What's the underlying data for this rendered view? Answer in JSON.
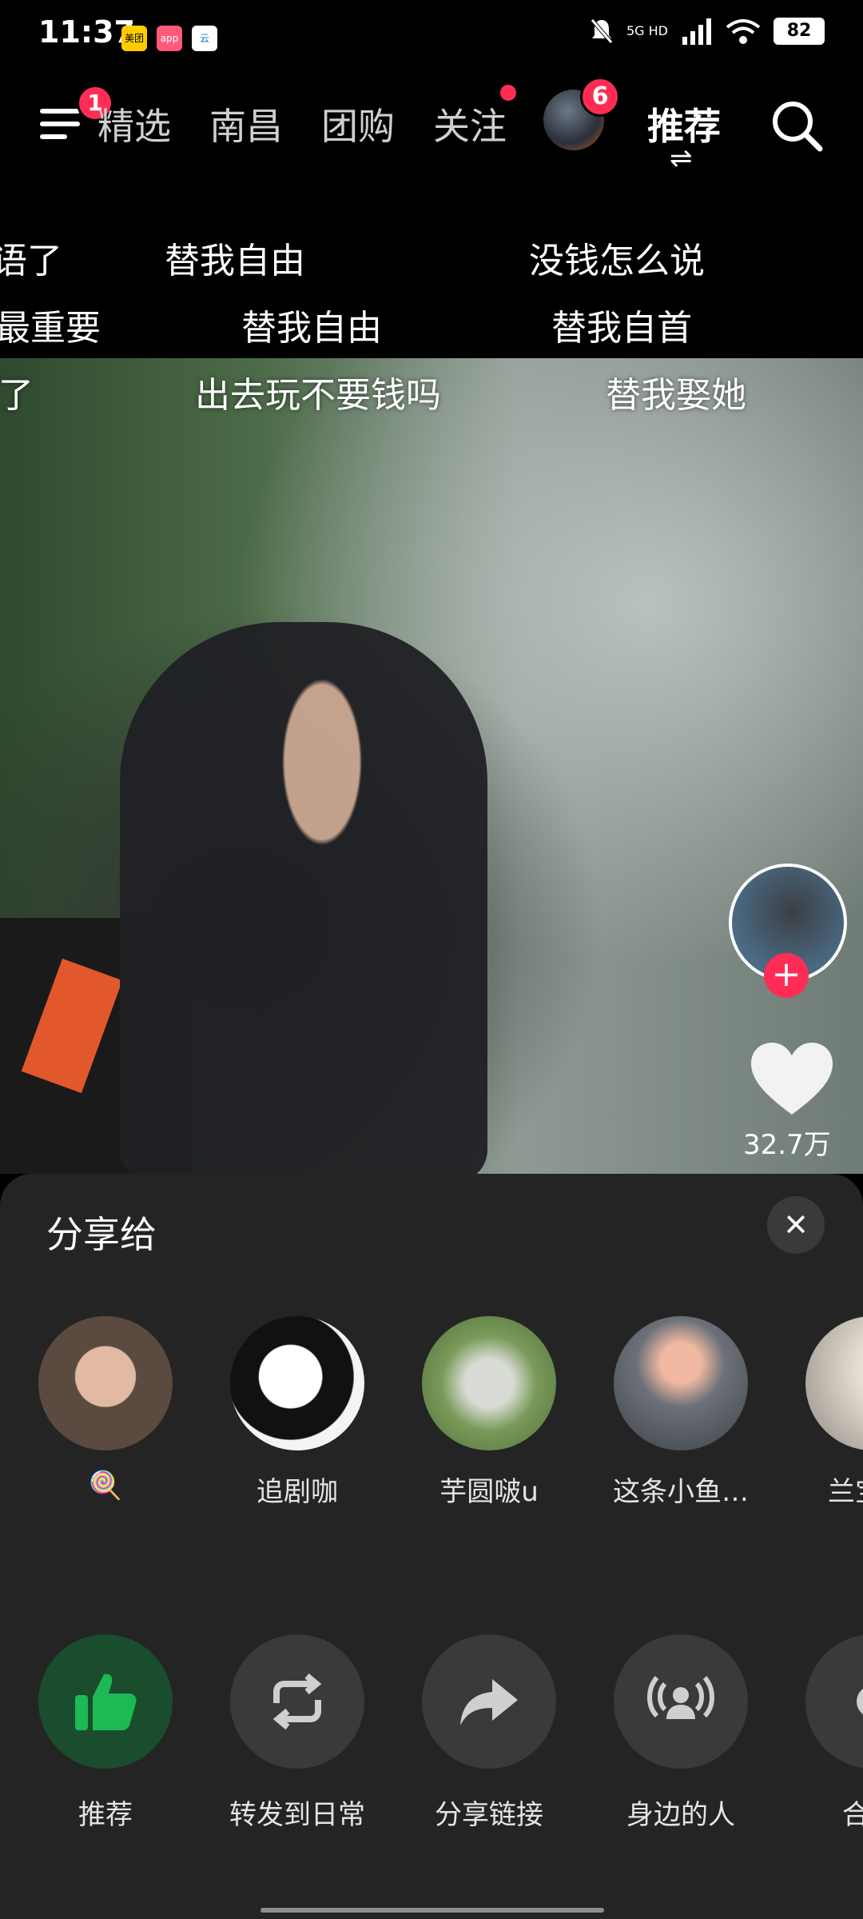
{
  "status_bar": {
    "time": "11:37",
    "app_icons": [
      "美团",
      "app",
      "云"
    ],
    "network": "5G HD",
    "battery": "82"
  },
  "nav": {
    "menu_badge": "1",
    "tabs": [
      "精选",
      "南昌",
      "团购",
      "关注"
    ],
    "avatar_badge": "6",
    "active_tab": "推荐",
    "switch_icon": "⇌"
  },
  "danmaku": [
    "语了",
    "替我自由",
    "没钱怎么说",
    "最重要",
    "替我自由",
    "替我自首",
    "了",
    "出去玩不要钱吗",
    "替我娶她"
  ],
  "video": {
    "like_count": "32.7万"
  },
  "share_sheet": {
    "title": "分享给",
    "close": "✕",
    "contacts": [
      {
        "name": "🍭"
      },
      {
        "name": "追剧咖"
      },
      {
        "name": "芋圆啵u"
      },
      {
        "name": "这条小鱼…"
      },
      {
        "name": "兰宝"
      }
    ],
    "actions": [
      {
        "label": "推荐",
        "icon": "thumbs-up-icon",
        "color": "#1db954"
      },
      {
        "label": "转发到日常",
        "icon": "repost-icon"
      },
      {
        "label": "分享链接",
        "icon": "share-arrow-icon"
      },
      {
        "label": "身边的人",
        "icon": "nearby-broadcast-icon"
      },
      {
        "label": "合",
        "icon": "more-icon"
      }
    ]
  },
  "colors": {
    "accent_red": "#ff2d55",
    "sheet_bg": "#242424",
    "recommend_green": "#1db954"
  }
}
